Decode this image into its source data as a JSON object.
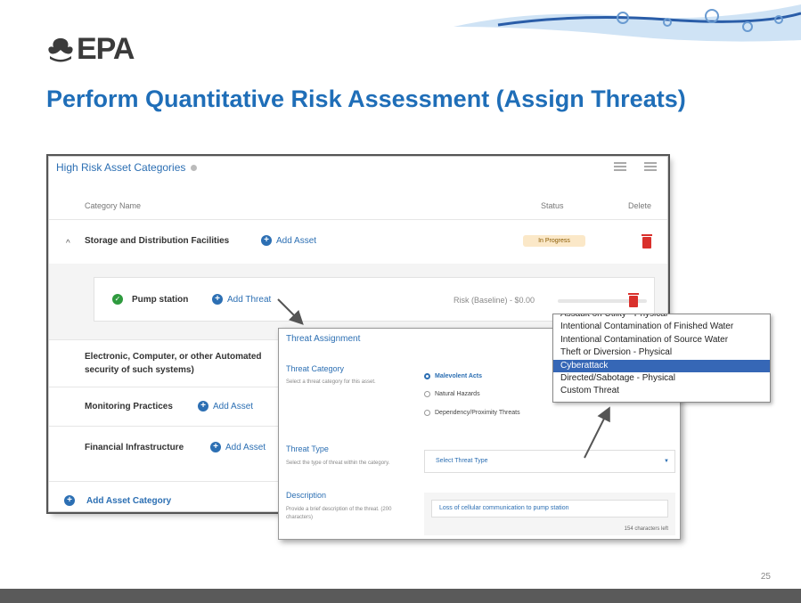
{
  "slide": {
    "logo": "EPA",
    "title": "Perform Quantitative Risk Assessment (Assign Threats)",
    "page_number": "25"
  },
  "panel": {
    "title": "High Risk Asset Categories",
    "columns": {
      "name": "Category Name",
      "status": "Status",
      "delete": "Delete"
    },
    "categories": [
      {
        "name": "Storage and Distribution Facilities",
        "add_label": "Add Asset",
        "status": "In Progress"
      },
      {
        "name_line1": "Electronic, Computer, or other Automated",
        "name_line2": "security of such systems)"
      },
      {
        "name": "Monitoring Practices",
        "add_label": "Add Asset"
      },
      {
        "name": "Financial Infrastructure",
        "add_label": "Add Asset"
      }
    ],
    "asset": {
      "name": "Pump station",
      "add_label": "Add Threat",
      "risk": "Risk (Baseline) - $0.00"
    },
    "add_category_label": "Add Asset Category"
  },
  "dialog": {
    "title": "Threat Assignment",
    "category_label": "Threat Category",
    "category_help": "Select a threat category for this asset.",
    "options": [
      "Malevolent Acts",
      "Natural Hazards",
      "Dependency/Proximity Threats"
    ],
    "type_label": "Threat Type",
    "type_help": "Select the type of threat within the category.",
    "type_placeholder": "Select Threat Type",
    "desc_label": "Description",
    "desc_help": "Provide a brief description of the threat. (200 characters)",
    "desc_value": "Loss of cellular communication to pump station",
    "char_count": "154 characters left"
  },
  "dropdown": {
    "items": [
      "Assault on Utility - Physical",
      "Intentional Contamination of Finished Water",
      "Intentional Contamination of Source Water",
      "Theft or Diversion - Physical",
      "Cyberattack",
      "Directed/Sabotage - Physical",
      "Custom Threat"
    ],
    "selected": "Cyberattack"
  }
}
